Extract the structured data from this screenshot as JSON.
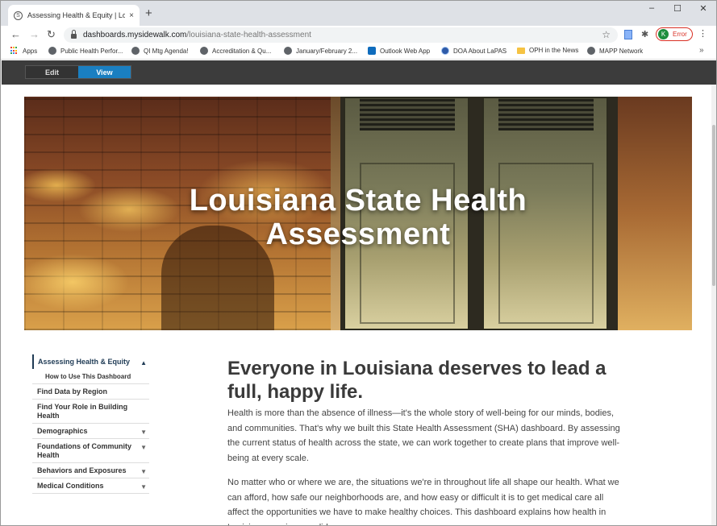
{
  "browser": {
    "tab_title": "Assessing Health & Equity | Louisi",
    "tab_close": "×",
    "new_tab": "+",
    "url_host": "dashboards.mysidewalk.com",
    "url_path": "/louisiana-state-health-assessment",
    "profile_initial": "K",
    "profile_label": "Error",
    "window_controls": [
      "–",
      "☐",
      "✕"
    ]
  },
  "bookmarks": [
    {
      "label": "Apps",
      "icon": "apps-grid-icon"
    },
    {
      "label": "Public Health Perfor...",
      "icon": "globe-icon"
    },
    {
      "label": "QI Mtg Agenda!",
      "icon": "globe-icon"
    },
    {
      "label": "Accreditation & Qu...",
      "icon": "globe-icon"
    },
    {
      "label": "January/February 2...",
      "icon": "globe-icon"
    },
    {
      "label": "Outlook Web App",
      "icon": "outlook-icon"
    },
    {
      "label": "DOA About LaPAS",
      "icon": "doa-icon"
    },
    {
      "label": "OPH in the News",
      "icon": "folder-icon"
    },
    {
      "label": "MAPP Network",
      "icon": "globe-icon"
    }
  ],
  "bookmarks_more": "»",
  "editor": {
    "edit_label": "Edit",
    "view_label": "View"
  },
  "hero": {
    "title_line1": "Louisiana State Health",
    "title_line2": "Assessment"
  },
  "sidebar": {
    "items": [
      {
        "label": "Assessing Health & Equity",
        "arrow": "▲"
      },
      {
        "label": "How to Use This Dashboard"
      },
      {
        "label": "Find Data by Region"
      },
      {
        "label": "Find Your Role in Building Health"
      },
      {
        "label": "Demographics",
        "arrow": "▼"
      },
      {
        "label": "Foundations of Community Health",
        "arrow": "▼"
      },
      {
        "label": "Behaviors and Exposures",
        "arrow": "▼"
      },
      {
        "label": "Medical Conditions",
        "arrow": "▼"
      }
    ]
  },
  "article": {
    "heading": "Everyone in Louisiana deserves to lead a full, happy life.",
    "paragraph1": "Health is more than the absence of illness—it's the whole story of well-being for our minds, bodies, and communities. That's why we built this State Health Assessment (SHA) dashboard. By assessing the current status of health across the state, we can work together to create plans that improve well-being at every scale.",
    "paragraph2": "No matter who or where we are, the situations we're in throughout life all shape our health. What we can afford, how safe our neighborhoods are, and how easy or difficult it is to get medical care all affect the opportunities we have to make healthy choices. This dashboard explains how health in Louisiana requires a solid"
  }
}
